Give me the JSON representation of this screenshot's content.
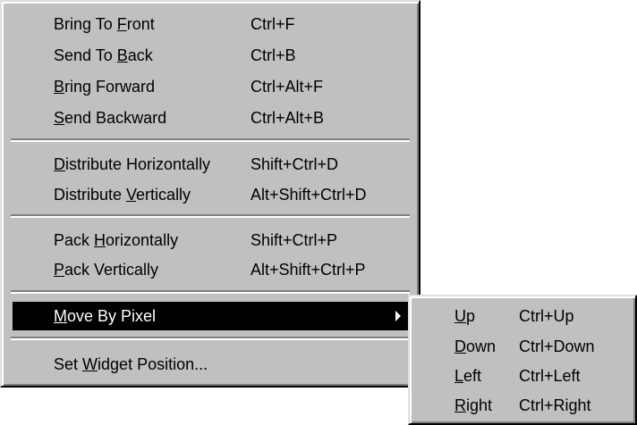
{
  "menu": {
    "items": [
      {
        "pre": "Bring To ",
        "mn": "F",
        "post": "ront",
        "shortcut": "Ctrl+F"
      },
      {
        "pre": "Send To ",
        "mn": "B",
        "post": "ack",
        "shortcut": "Ctrl+B"
      },
      {
        "pre": "",
        "mn": "B",
        "post": "ring Forward",
        "shortcut": "Ctrl+Alt+F"
      },
      {
        "pre": "",
        "mn": "S",
        "post": "end Backward",
        "shortcut": "Ctrl+Alt+B"
      },
      {
        "pre": "",
        "mn": "D",
        "post": "istribute Horizontally",
        "shortcut": "Shift+Ctrl+D"
      },
      {
        "pre": "Distribute ",
        "mn": "V",
        "post": "ertically",
        "shortcut": "Alt+Shift+Ctrl+D"
      },
      {
        "pre": "Pack ",
        "mn": "H",
        "post": "orizontally",
        "shortcut": "Shift+Ctrl+P"
      },
      {
        "pre": "",
        "mn": "P",
        "post": "ack Vertically",
        "shortcut": "Alt+Shift+Ctrl+P"
      },
      {
        "pre": "",
        "mn": "M",
        "post": "ove By Pixel",
        "shortcut": ""
      },
      {
        "pre": "Set ",
        "mn": "W",
        "post": "idget Position...",
        "shortcut": ""
      }
    ]
  },
  "submenu": {
    "items": [
      {
        "pre": "",
        "mn": "U",
        "post": "p",
        "shortcut": "Ctrl+Up"
      },
      {
        "pre": "",
        "mn": "D",
        "post": "own",
        "shortcut": "Ctrl+Down"
      },
      {
        "pre": "",
        "mn": "L",
        "post": "eft",
        "shortcut": "Ctrl+Left"
      },
      {
        "pre": "",
        "mn": "R",
        "post": "ight",
        "shortcut": "Ctrl+Right"
      }
    ]
  },
  "colors": {
    "menu_face": "#c0c0c0",
    "highlight_bg": "#000000",
    "highlight_fg": "#ffffff"
  }
}
